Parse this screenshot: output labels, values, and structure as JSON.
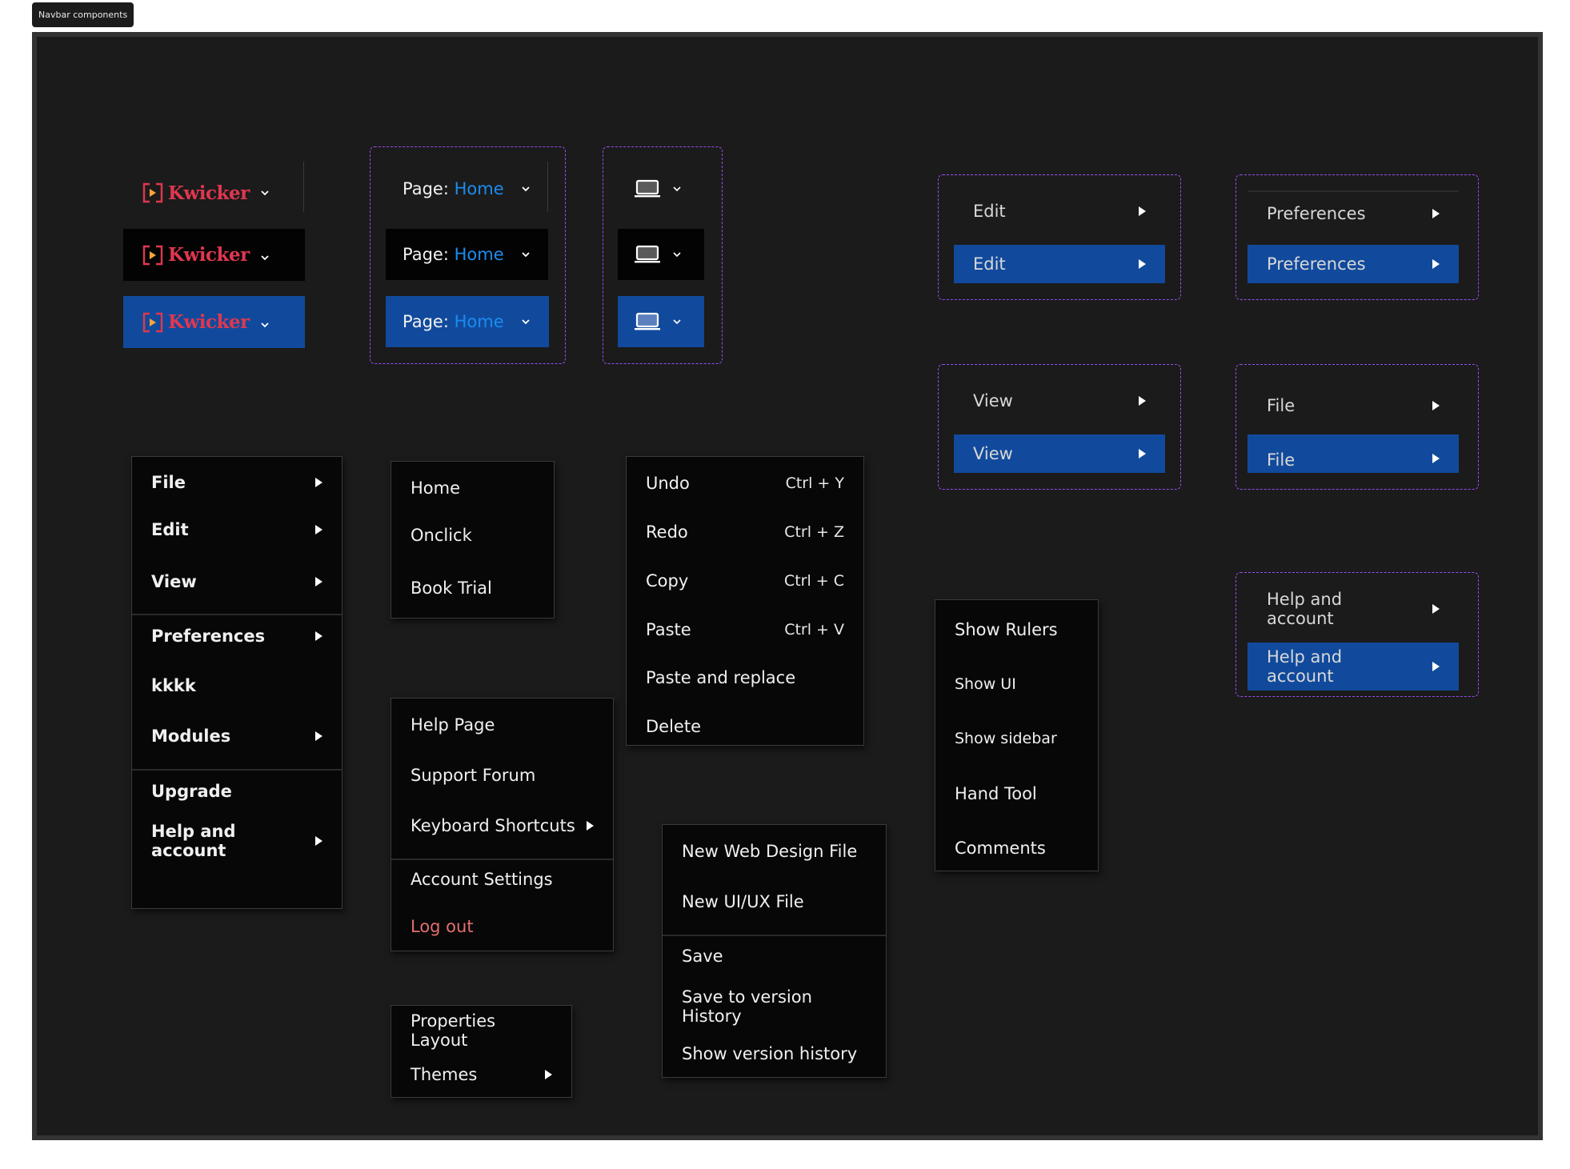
{
  "frame_label": "Navbar components",
  "brand": {
    "name": "Kwicker",
    "colors": {
      "brand_red": "#e0374f",
      "arrow_orange": "#f5a43a"
    }
  },
  "colors": {
    "canvas": "#1b1b1b",
    "hover_black": "#030303",
    "selected_blue": "#114a9c",
    "link_blue": "#1a8cf0",
    "variant_outline": "#9a4df0",
    "logout_red": "#e36f6f"
  },
  "logo_variants": [
    {
      "state": "default"
    },
    {
      "state": "hover"
    },
    {
      "state": "selected"
    }
  ],
  "page_selector": {
    "prefix": "Page:",
    "value": "Home"
  },
  "device_icon": "laptop-icon",
  "variant_items": {
    "edit": "Edit",
    "preferences": "Preferences",
    "view": "View",
    "file": "File",
    "help": "Help and account"
  },
  "main_menu": {
    "items": [
      {
        "label": "File",
        "submenu": true
      },
      {
        "label": "Edit",
        "submenu": true
      },
      {
        "label": "View",
        "submenu": true
      },
      {
        "label": "Preferences",
        "submenu": true
      },
      {
        "label": "kkkk",
        "submenu": false
      },
      {
        "label": "Modules",
        "submenu": true
      },
      {
        "label": "Upgrade",
        "submenu": false
      },
      {
        "label": "Help and account",
        "submenu": true
      }
    ]
  },
  "pages_menu": {
    "items": [
      "Home",
      "Onclick",
      "Book Trial"
    ]
  },
  "help_menu": {
    "items": [
      {
        "label": "Help Page"
      },
      {
        "label": "Support Forum"
      },
      {
        "label": "Keyboard Shortcuts",
        "submenu": true
      },
      {
        "label": "Account Settings"
      },
      {
        "label": "Log out",
        "danger": true
      }
    ]
  },
  "properties_menu": {
    "items": [
      {
        "label": "Properties Layout"
      },
      {
        "label": "Themes",
        "submenu": true
      }
    ]
  },
  "edit_menu": {
    "items": [
      {
        "label": "Undo",
        "shortcut": "Ctrl + Y"
      },
      {
        "label": "Redo",
        "shortcut": "Ctrl + Z"
      },
      {
        "label": "Copy",
        "shortcut": "Ctrl + C"
      },
      {
        "label": "Paste",
        "shortcut": "Ctrl + V"
      },
      {
        "label": "Paste and replace",
        "shortcut": ""
      },
      {
        "label": "Delete",
        "shortcut": ""
      }
    ]
  },
  "file_menu": {
    "items": [
      "New Web Design File",
      "New UI/UX File",
      "Save",
      "Save to version History",
      "Show version history"
    ]
  },
  "view_menu": {
    "items": [
      "Show Rulers",
      "Show UI",
      "Show sidebar",
      "Hand Tool",
      "Comments"
    ]
  }
}
